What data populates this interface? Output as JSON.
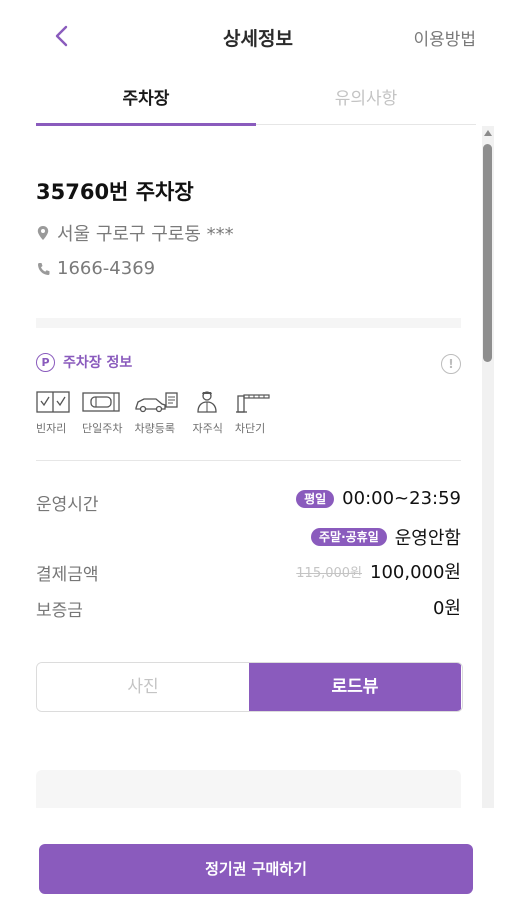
{
  "header": {
    "title": "상세정보",
    "howto_label": "이용방법"
  },
  "tabs": [
    {
      "label": "주차장"
    },
    {
      "label": "유의사항"
    }
  ],
  "lot": {
    "name": "35760번 주차장",
    "address": "서울 구로구 구로동 ***",
    "phone": "1666-4369"
  },
  "info_section": {
    "title": "주차장 정보",
    "badge_letter": "P"
  },
  "features": [
    {
      "label": "빈자리",
      "icon": "checkbox-pair-icon"
    },
    {
      "label": "단일주차",
      "icon": "single-car-icon"
    },
    {
      "label": "차량등록",
      "icon": "car-register-icon"
    },
    {
      "label": "자주식",
      "icon": "self-park-person-icon"
    },
    {
      "label": "차단기",
      "icon": "barrier-gate-icon"
    }
  ],
  "details": {
    "hours_label": "운영시간",
    "weekday_badge": "평일",
    "weekday_hours": "00:00~23:59",
    "weekend_badge": "주말·공휴일",
    "weekend_hours": "운영안함",
    "price_label": "결제금액",
    "price_original": "115,000원",
    "price_final": "100,000원",
    "deposit_label": "보증금",
    "deposit_value": "0원"
  },
  "view_toggle": {
    "photo_label": "사진",
    "roadview_label": "로드뷰",
    "selected": "로드뷰"
  },
  "footer": {
    "buy_label": "정기권 구매하기"
  },
  "colors": {
    "accent": "#8a5bbd",
    "muted": "#7a7a7a"
  }
}
